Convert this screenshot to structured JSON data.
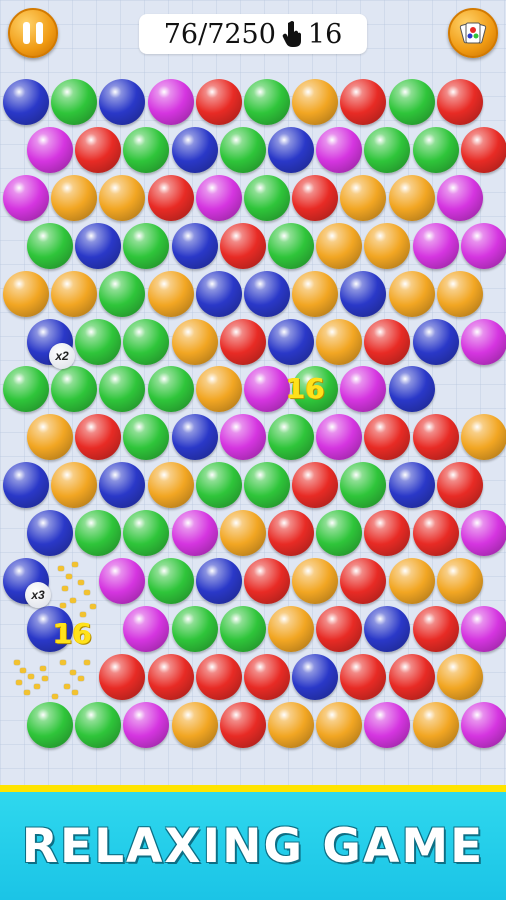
{
  "hud": {
    "moves_used": "76",
    "moves_separator": "/",
    "score": "7250",
    "taps_remaining": "16",
    "pause_icon": "pause-icon",
    "cards_icon": "cards-icon",
    "hand_icon": "hand-tap-icon"
  },
  "board": {
    "colors": {
      "B": "#2a38c8",
      "G": "#2fc53a",
      "P": "#d535e0",
      "R": "#e82b25",
      "O": "#f2a623"
    },
    "rows": [
      "BGBPRGORGR",
      "PRGBGBPGGR",
      "POORPGROOP",
      "GBGBRGOOPP",
      "OOGOBBOBOO",
      "BGGORBORBP",
      "GGGGOPGPB",
      "ORGBPGPRRO",
      "BOBOGGRGBR",
      "BGGPORGRRP",
      "BPGBROROO",
      "BPGGORBRP",
      "RRRRBRRO",
      "GGPOROOPOP"
    ],
    "multipliers": [
      {
        "row": 5,
        "col": 0,
        "label": "x2"
      },
      {
        "row": 10,
        "col": 0,
        "label": "x3"
      }
    ],
    "popups": [
      "16",
      "16"
    ]
  },
  "banner": {
    "text": "RELAXING GAME"
  }
}
